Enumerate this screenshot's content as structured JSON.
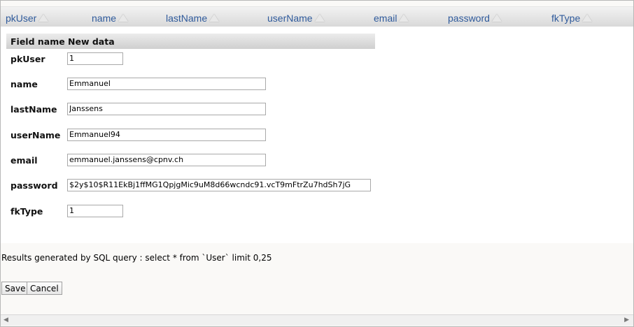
{
  "columns": [
    "pkUser",
    "name",
    "lastName",
    "userName",
    "email",
    "password",
    "fkType"
  ],
  "form": {
    "header_field": "Field name",
    "header_value": "New data",
    "fields": [
      {
        "label": "pkUser",
        "value": "1"
      },
      {
        "label": "name",
        "value": "Emmanuel"
      },
      {
        "label": "lastName",
        "value": "Janssens"
      },
      {
        "label": "userName",
        "value": "Emmanuel94"
      },
      {
        "label": "email",
        "value": "emmanuel.janssens@cpnv.ch"
      },
      {
        "label": "password",
        "value": "$2y$10$R11EkBj1ffMG1QpjgMic9uM8d66wcndc91.vcT9mFtrZu7hdSh7jG"
      },
      {
        "label": "fkType",
        "value": "1"
      }
    ]
  },
  "query_text": "Results generated by SQL query : select * from `User` limit 0,25",
  "buttons": {
    "save": "Save",
    "cancel": "Cancel"
  },
  "scrollbar": {
    "left_arrow": "◀",
    "right_arrow": "▶"
  },
  "colors": {
    "header_link": "#2f5a9b"
  }
}
